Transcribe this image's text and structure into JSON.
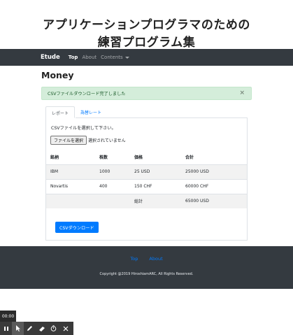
{
  "page_title": {
    "line1": "アプリケーションプログラマのための",
    "line2": "練習プログラム集"
  },
  "navbar": {
    "brand": "Etude",
    "links": [
      "Top",
      "About",
      "Contents"
    ]
  },
  "heading": "Money",
  "alert": {
    "message": "CSVファイルダウンロード完了しました",
    "close": "×"
  },
  "tabs": [
    "レポート",
    "為替レート"
  ],
  "upload": {
    "prompt": "CSVファイルを選択して下さい。",
    "button": "ファイルを選択",
    "status": "選択されていません"
  },
  "table": {
    "headers": [
      "銘柄",
      "株数",
      "価格",
      "合計"
    ],
    "rows": [
      [
        "IBM",
        "1000",
        "25 USD",
        "25000 USD"
      ],
      [
        "Novartis",
        "400",
        "150 CHF",
        "60000 CHF"
      ],
      [
        "",
        "",
        "総計",
        "65000 USD"
      ]
    ]
  },
  "download_button": "CSVダウンロード",
  "footer": {
    "links": [
      "Top",
      "About"
    ],
    "copyright": "Copyright @2019 HiroshiamARC, All Rights Reserved."
  },
  "recorder": {
    "time": "00:00",
    "tools": [
      "pause-icon",
      "pointer-icon",
      "pen-icon",
      "highlighter-icon",
      "timer-icon",
      "close-icon"
    ]
  },
  "colors": {
    "navbar": "#343a40",
    "alert_bg": "#d4edda",
    "alert_text": "#155724",
    "primary": "#007bff"
  }
}
